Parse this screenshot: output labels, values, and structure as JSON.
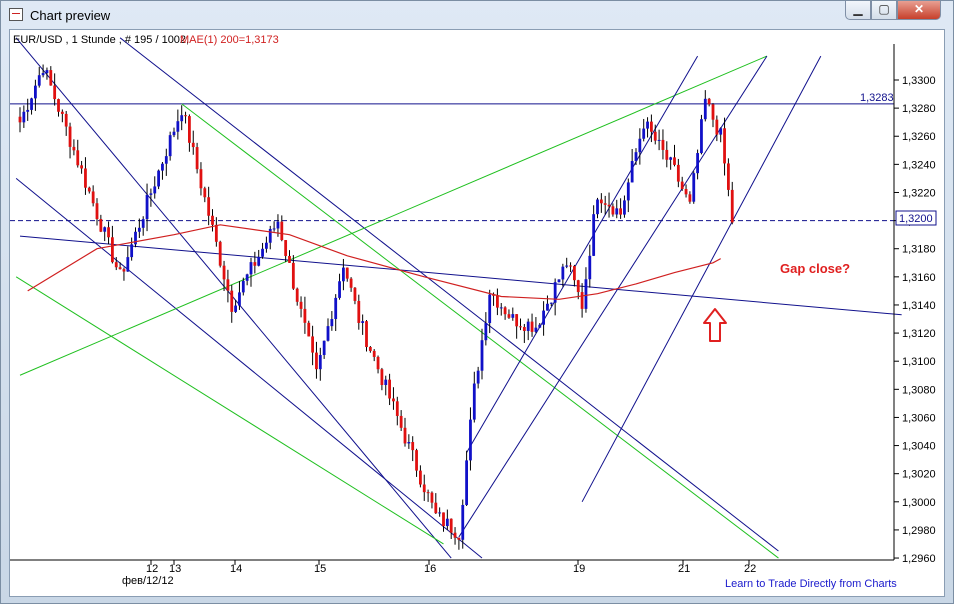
{
  "window": {
    "title": "Chart preview",
    "buttons": {
      "minimize": "▁",
      "maximize": "▢",
      "close": "✕"
    }
  },
  "chart_header": {
    "symbol_info": "EUR/USD , 1 Stunde , # 195 / 1002,",
    "indicator": "MAE(1) 200=1,3173"
  },
  "annotations": {
    "gap_text": "Gap close?",
    "learn_link": "Learn to Trade Directly from Charts",
    "current_price": "1,3200",
    "level_label": "1,3283",
    "date_label": "фев/12/12"
  },
  "colors": {
    "up_candle": "#1010c8",
    "down_candle": "#e01010",
    "trend_blue": "#10108c",
    "trend_green": "#20c020",
    "ma": "#d02020",
    "arrow": "#e02020"
  },
  "chart_data": {
    "type": "candlestick",
    "ylim": [
      1.296,
      1.333
    ],
    "yticks": [
      "1,2960",
      "1,2980",
      "1,3000",
      "1,3020",
      "1,3040",
      "1,3060",
      "1,3080",
      "1,3100",
      "1,3120",
      "1,3140",
      "1,3160",
      "1,3180",
      "1,3200",
      "1,3220",
      "1,3240",
      "1,3260",
      "1,3280",
      "1,3300"
    ],
    "xticks": [
      "12",
      "13",
      "14",
      "15",
      "16",
      "19",
      "21",
      "22"
    ],
    "horizontal_levels": [
      {
        "value": 1.3283,
        "style": "solid",
        "label": "1,3283"
      },
      {
        "value": 1.32,
        "style": "dashed",
        "label": "1,3200"
      }
    ],
    "indicator_name": "MAE(1) 200",
    "indicator_last": 1.3173,
    "last_price": 1.32,
    "key_points": [
      {
        "t": 0,
        "price": 1.327
      },
      {
        "t": 6,
        "price": 1.331
      },
      {
        "t": 26,
        "price": 1.316
      },
      {
        "t": 42,
        "price": 1.328
      },
      {
        "t": 55,
        "price": 1.314
      },
      {
        "t": 67,
        "price": 1.32
      },
      {
        "t": 77,
        "price": 1.309
      },
      {
        "t": 84,
        "price": 1.317
      },
      {
        "t": 88,
        "price": 1.313
      },
      {
        "t": 108,
        "price": 1.299
      },
      {
        "t": 114,
        "price": 1.2978
      },
      {
        "t": 118,
        "price": 1.308
      },
      {
        "t": 122,
        "price": 1.315
      },
      {
        "t": 128,
        "price": 1.313
      },
      {
        "t": 134,
        "price": 1.3125
      },
      {
        "t": 142,
        "price": 1.317
      },
      {
        "t": 146,
        "price": 1.314
      },
      {
        "t": 150,
        "price": 1.322
      },
      {
        "t": 156,
        "price": 1.3205
      },
      {
        "t": 162,
        "price": 1.327
      },
      {
        "t": 170,
        "price": 1.3235
      },
      {
        "t": 174,
        "price": 1.321
      },
      {
        "t": 178,
        "price": 1.3285
      },
      {
        "t": 182,
        "price": 1.326
      },
      {
        "t": 185,
        "price": 1.32
      }
    ]
  }
}
